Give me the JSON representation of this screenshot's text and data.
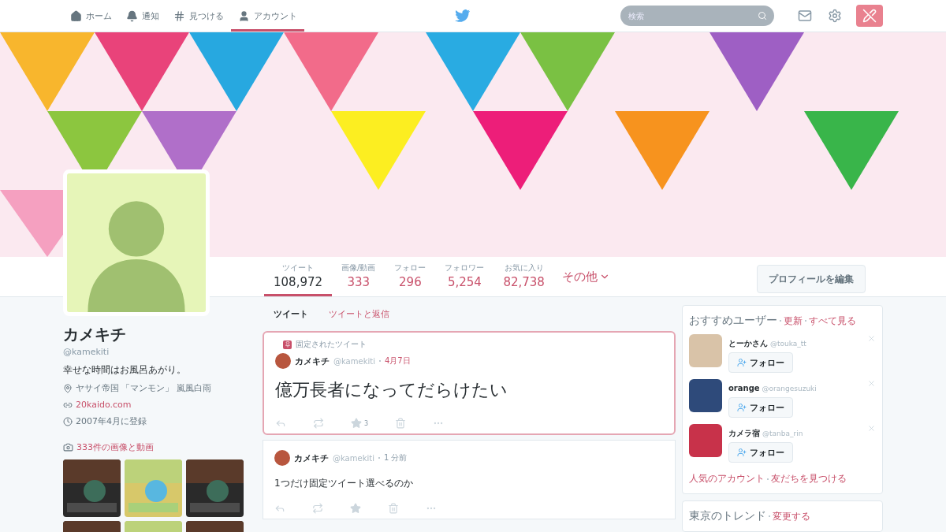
{
  "nav": {
    "items": [
      {
        "label": "ホーム",
        "selected": false
      },
      {
        "label": "通知",
        "selected": false
      },
      {
        "label": "見つける",
        "selected": false
      },
      {
        "label": "アカウント",
        "selected": true
      }
    ],
    "search": {
      "placeholder": "検索"
    }
  },
  "profile": {
    "name": "カメキチ",
    "handle": "@kamekiti",
    "bio": "幸せな時間はお風呂あがり。",
    "location": "ヤサイ帝国 「マンモン」 嵐風白雨",
    "url": "20kaido.com",
    "joined": "2007年4月に登録",
    "media_link": "333件の画像と動画"
  },
  "stats": [
    {
      "label": "ツイート",
      "value": "108,972",
      "selected": true
    },
    {
      "label": "画像/動画",
      "value": "333",
      "selected": false
    },
    {
      "label": "フォロー",
      "value": "296",
      "selected": false
    },
    {
      "label": "フォロワー",
      "value": "5,254",
      "selected": false
    },
    {
      "label": "お気に入り",
      "value": "82,738",
      "selected": false
    }
  ],
  "more": "その他",
  "edit_button": "プロフィールを編集",
  "timeline_tabs": [
    {
      "label": "ツイート",
      "selected": true
    },
    {
      "label": "ツイートと返信",
      "selected": false
    }
  ],
  "tweets": [
    {
      "pinned": true,
      "pinned_label": "固定されたツイート",
      "name": "カメキチ",
      "handle": "@kamekiti",
      "time": "4月7日",
      "text": "億万長者になってだらけたい",
      "favorites": "3"
    },
    {
      "pinned": false,
      "name": "カメキチ",
      "handle": "@kamekiti",
      "time": "1 分前",
      "text": "1つだけ固定ツイート選べるのか"
    }
  ],
  "who_to_follow": {
    "title": "おすすめユーザー",
    "refresh": "更新",
    "view_all": "すべて見る",
    "users": [
      {
        "name": "とーかさん",
        "handle": "@touka_tt",
        "button": "フォロー",
        "color": "#d9c3a8"
      },
      {
        "name": "orange",
        "handle": "@orangesuzuki",
        "button": "フォロー",
        "color": "#2e4a7a"
      },
      {
        "name": "カメラ宿",
        "handle": "@tanba_rin",
        "button": "フォロー",
        "color": "#c8324a"
      }
    ],
    "footer_links": [
      "人気のアカウント",
      "友だちを見つける"
    ]
  },
  "trends": {
    "title": "東京のトレンド",
    "change": "変更する"
  }
}
